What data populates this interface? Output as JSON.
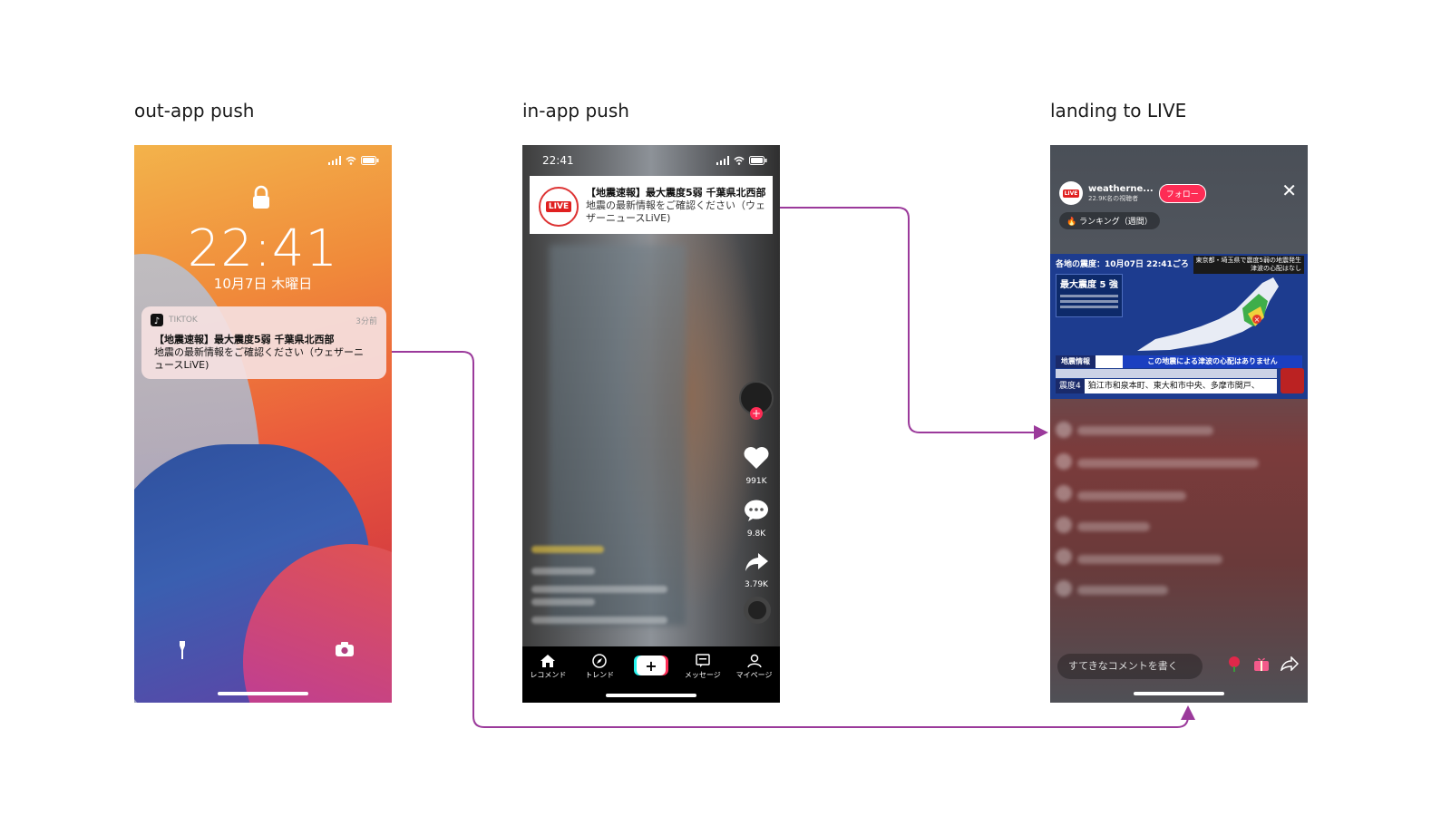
{
  "labels": {
    "out_app": "out-app push",
    "in_app": "in-app push",
    "landing": "landing to LIVE"
  },
  "lock_screen": {
    "time": "22:41",
    "date": "10月7日 木曜日",
    "notification": {
      "app_name": "TIKTOK",
      "time_ago": "3分前",
      "title": "【地震速報】最大震度5弱 千葉県北西部",
      "body": "地震の最新情報をご確認ください（ウェザーニュースLiVE)"
    }
  },
  "in_app": {
    "status_time": "22:41",
    "banner": {
      "logo_text": "LIVE",
      "title": "【地震速報】最大震度5弱 千葉県北西部",
      "body": "地震の最新情報をご確認ください（ウェザーニュースLiVE)"
    },
    "counts": {
      "likes": "991K",
      "comments": "9.8K",
      "shares": "3.79K"
    },
    "tabs": [
      {
        "label": "レコメンド",
        "icon": "home-icon"
      },
      {
        "label": "トレンド",
        "icon": "compass-icon"
      },
      {
        "label": "",
        "icon": "create-icon"
      },
      {
        "label": "メッセージ",
        "icon": "message-icon"
      },
      {
        "label": "マイページ",
        "icon": "profile-icon"
      }
    ]
  },
  "live": {
    "channel": "weatherne...",
    "viewers": "22.9K名の視聴者",
    "follow": "フォロー",
    "ranking": "ランキング（週間）",
    "broadcast": {
      "header": "各地の震度：10月07日 22:41ごろ",
      "header_right_1": "東京都・埼玉県で震度5弱の地震発生",
      "header_right_2": "津波の心配はなし",
      "max_intensity": "最大震度 5 強",
      "ticker_tag": "地震情報",
      "ticker_msg": "この地震による津波の心配はありません",
      "intensity_level": "震度4",
      "areas": "狛江市和泉本町、東大和市中央、多摩市関戸、"
    },
    "comment_placeholder": "すてきなコメントを書く"
  },
  "colors": {
    "connector": "#9b3a9b",
    "tiktok_red": "#fe2c55",
    "tiktok_cyan": "#25f4ee"
  }
}
